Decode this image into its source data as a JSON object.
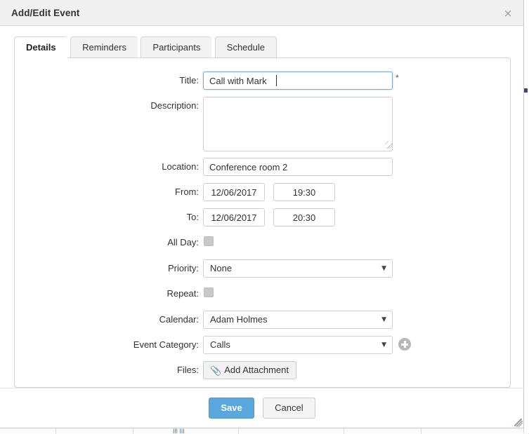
{
  "window": {
    "title": "Add/Edit Event",
    "close_icon": "close-icon",
    "close_glyph": "×"
  },
  "tabs": [
    {
      "label": "Details",
      "active": true
    },
    {
      "label": "Reminders",
      "active": false
    },
    {
      "label": "Participants",
      "active": false
    },
    {
      "label": "Schedule",
      "active": false
    }
  ],
  "form": {
    "title": {
      "label": "Title:",
      "value": "Call with Mark",
      "placeholder": "",
      "required_marker": "*",
      "focused": true
    },
    "description": {
      "label": "Description:",
      "value": "",
      "placeholder": ""
    },
    "location": {
      "label": "Location:",
      "value": "Conference room 2",
      "placeholder": ""
    },
    "from": {
      "label": "From:",
      "date": "12/06/2017",
      "time": "19:30"
    },
    "to": {
      "label": "To:",
      "date": "12/06/2017",
      "time": "20:30"
    },
    "all_day": {
      "label": "All Day:",
      "checked": false
    },
    "priority": {
      "label": "Priority:",
      "value": "None",
      "arrow_glyph": "▼"
    },
    "repeat": {
      "label": "Repeat:",
      "checked": false
    },
    "calendar": {
      "label": "Calendar:",
      "value": "Adam Holmes",
      "arrow_glyph": "▼"
    },
    "event_category": {
      "label": "Event Category:",
      "value": "Calls",
      "arrow_glyph": "▼",
      "add_icon": "plus-circle-icon"
    },
    "files": {
      "label": "Files:",
      "button_label": "Add Attachment",
      "clip_glyph": "📎"
    }
  },
  "footer": {
    "save_label": "Save",
    "cancel_label": "Cancel"
  },
  "colors": {
    "accent": "#5aa7dd",
    "titlebar": "#f0f0f0",
    "focus_border": "#7aa7d9",
    "border": "#cfcfcf",
    "text": "#333333"
  },
  "background": {
    "grid_text": "||| |||"
  }
}
